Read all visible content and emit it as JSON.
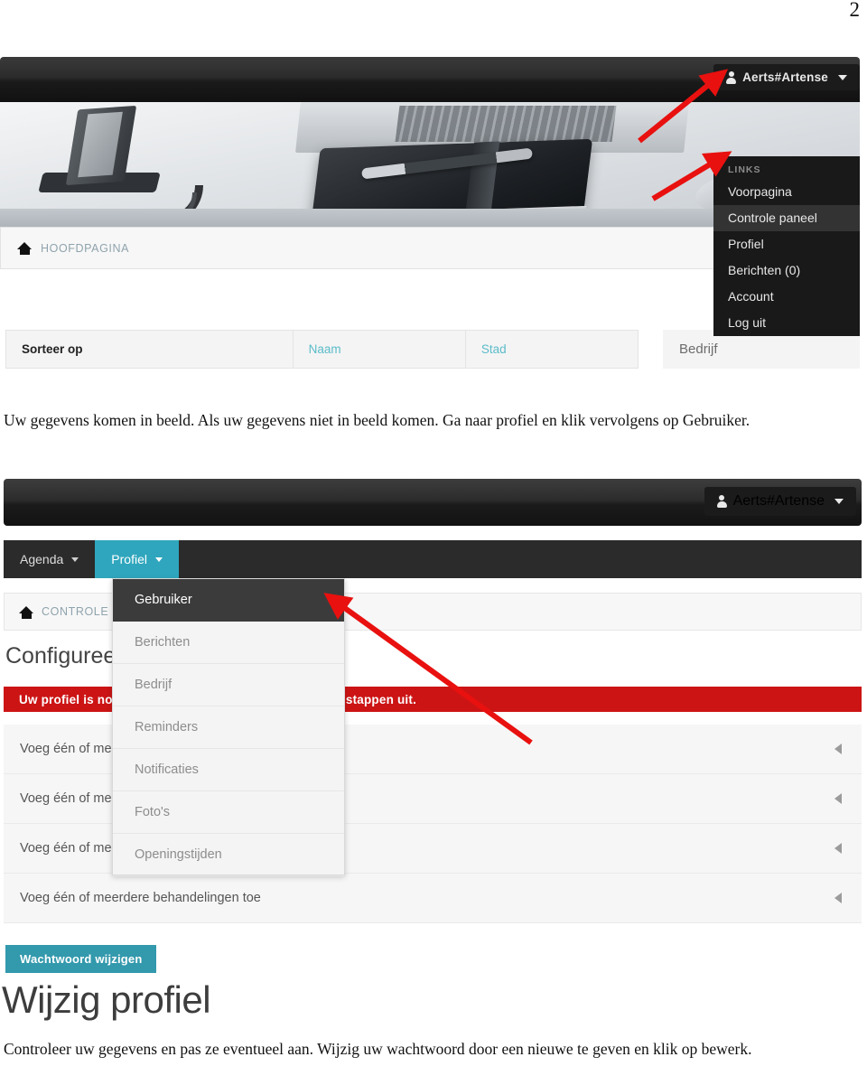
{
  "document": {
    "page_number": "2"
  },
  "screenshot1": {
    "user_menu": {
      "username": "Aerts#Artense",
      "icon": "person-icon",
      "caret": "chevron-down-icon",
      "section_label": "LINKS",
      "items": [
        {
          "label": "Voorpagina",
          "active": false
        },
        {
          "label": "Controle paneel",
          "active": true
        },
        {
          "label": "Profiel",
          "active": false
        },
        {
          "label": "Berichten (0)",
          "active": false
        },
        {
          "label": "Account",
          "active": false
        },
        {
          "label": "Log uit",
          "active": false
        }
      ]
    },
    "breadcrumb": {
      "icon": "home-icon",
      "label": "HOOFDPAGINA"
    },
    "sort_table": {
      "headers": [
        {
          "label": "Sorteer op",
          "is_link": false
        },
        {
          "label": "Naam",
          "is_link": true
        },
        {
          "label": "Stad",
          "is_link": true
        }
      ]
    },
    "side_panel": {
      "label": "Bedrijf"
    }
  },
  "instructions": {
    "text1": "Uw gegevens komen in beeld. Als uw gegevens niet in beeld komen. Ga naar profiel en klik vervolgens op Gebruiker.",
    "text2": "Controleer uw gegevens en pas ze eventueel aan. Wijzig uw wachtwoord door een nieuwe te geven en klik op bewerk."
  },
  "screenshot2": {
    "user_menu": {
      "username": "Aerts#Artense",
      "icon": "person-icon",
      "caret": "chevron-down-icon"
    },
    "nav_tabs": [
      {
        "label": "Agenda",
        "active": false
      },
      {
        "label": "Profiel",
        "active": true
      }
    ],
    "breadcrumb": {
      "icon": "home-icon",
      "label": "CONTROLE PANEEL"
    },
    "heading": "Configureer uw profiel",
    "alert": {
      "text": "Uw profiel is nog niet compleet, voer de onderstaande stappen uit.",
      "color": "#cc1414"
    },
    "rows": [
      {
        "label": "Voeg één of meerdere medewerkers toe",
        "toggle": "triangle-left-icon"
      },
      {
        "label": "Voeg één of meerdere medewerkers toe",
        "toggle": "triangle-left-icon"
      },
      {
        "label": "Voeg één of meerdere medewerkers toe",
        "toggle": "triangle-left-icon"
      },
      {
        "label": "Voeg één of meerdere behandelingen toe",
        "toggle": "triangle-left-icon"
      }
    ],
    "profile_dropdown": [
      {
        "label": "Gebruiker",
        "active": true
      },
      {
        "label": "Berichten",
        "active": false
      },
      {
        "label": "Bedrijf",
        "active": false
      },
      {
        "label": "Reminders",
        "active": false
      },
      {
        "label": "Notificaties",
        "active": false
      },
      {
        "label": "Foto's",
        "active": false
      },
      {
        "label": "Openingstijden",
        "active": false
      }
    ]
  },
  "bottom": {
    "password_button": "Wachtwoord wijzigen",
    "title": "Wijzig profiel"
  },
  "colors": {
    "accent_teal": "#2fa6bd",
    "button_teal": "#3399ad",
    "alert_red": "#cc1414",
    "arrow_red": "#e8110f",
    "link_blue": "#5bbcc9"
  }
}
